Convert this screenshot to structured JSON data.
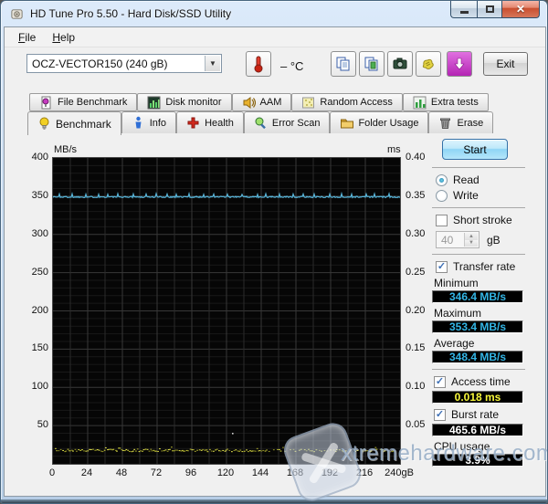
{
  "window": {
    "title": "HD Tune Pro 5.50 - Hard Disk/SSD Utility"
  },
  "menu": {
    "items": [
      "File",
      "Help"
    ]
  },
  "toolbar": {
    "drive_select": "OCZ-VECTOR150 (240 gB)",
    "temp_value": "– °C",
    "icons": [
      "copy-text-icon",
      "copy-image-icon",
      "camera-icon",
      "export-icon",
      "download-arrow-icon"
    ],
    "exit_label": "Exit"
  },
  "tabs": {
    "row1": [
      "File Benchmark",
      "Disk monitor",
      "AAM",
      "Random Access",
      "Extra tests"
    ],
    "row2": [
      "Benchmark",
      "Info",
      "Health",
      "Error Scan",
      "Folder Usage",
      "Erase"
    ],
    "active": "Benchmark"
  },
  "panel": {
    "start_label": "Start",
    "read_label": "Read",
    "write_label": "Write",
    "short_stroke_label": "Short stroke",
    "short_stroke_value": "40",
    "short_stroke_unit": "gB",
    "transfer_rate_label": "Transfer rate",
    "minimum_label": "Minimum",
    "minimum_value": "346.4 MB/s",
    "maximum_label": "Maximum",
    "maximum_value": "353.4 MB/s",
    "average_label": "Average",
    "average_value": "348.4 MB/s",
    "access_time_label": "Access time",
    "access_time_value": "0.018 ms",
    "burst_rate_label": "Burst rate",
    "burst_rate_value": "465.6 MB/s",
    "cpu_usage_label": "CPU usage",
    "cpu_usage_value": "3.9%"
  },
  "chart_data": {
    "type": "line",
    "ylabel_left": "MB/s",
    "ylabel_right": "ms",
    "x_unit": "gB",
    "x_range": [
      0,
      240
    ],
    "y_left_range": [
      0,
      400
    ],
    "y_right_range": [
      0,
      0.4
    ],
    "x_ticks": [
      0,
      24,
      48,
      72,
      96,
      120,
      144,
      168,
      192,
      216,
      240
    ],
    "y_left_ticks": [
      400,
      350,
      300,
      250,
      200,
      150,
      100,
      50
    ],
    "y_right_ticks": [
      "0.40",
      "0.35",
      "0.30",
      "0.25",
      "0.20",
      "0.15",
      "0.10",
      "0.05"
    ],
    "grid": true,
    "background": "#060606",
    "series": [
      {
        "name": "transfer-rate",
        "axis": "left",
        "unit": "MB/s",
        "color": "#58b7dc",
        "baseline": 349.0,
        "min": 346.4,
        "max": 353.4,
        "avg": 348.4,
        "shape": "flat-with-periodic-spikes"
      },
      {
        "name": "access-time",
        "axis": "right",
        "unit": "ms",
        "color": "#c9c93a",
        "value": 0.018,
        "shape": "scattered-dots"
      }
    ]
  },
  "watermark": {
    "text": "xtremehardware.com"
  }
}
